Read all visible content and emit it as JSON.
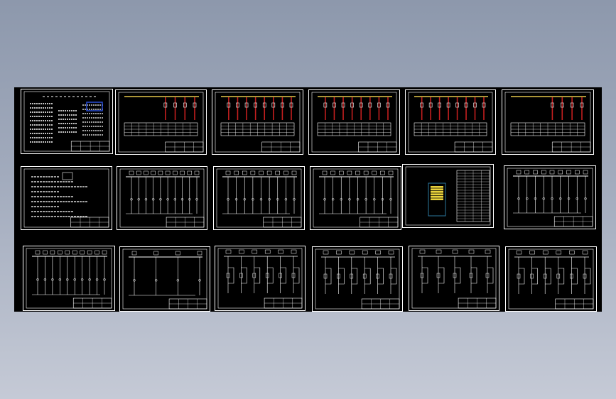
{
  "viewer": {
    "background_color": "#000000",
    "accent_colors": {
      "bus_yellow": "#e6c84a",
      "feeder_red": "#c41f1f",
      "line_white": "#ffffff",
      "cabinet_yellow": "#e8d23c",
      "cabinet_blue": "#2a4fd6",
      "cabinet_green": "#2fb84a"
    }
  },
  "sheets": [
    {
      "type": "index-sheet"
    },
    {
      "type": "feeder-table-sheet",
      "feeders": 4,
      "colored": true
    },
    {
      "type": "feeder-table-sheet",
      "feeders": 8,
      "colored": true
    },
    {
      "type": "feeder-table-sheet",
      "feeders": 8,
      "colored": true
    },
    {
      "type": "feeder-table-sheet",
      "feeders": 8,
      "colored": true
    },
    {
      "type": "feeder-table-sheet",
      "feeders": 4,
      "colored": true
    },
    {
      "type": "notes-sheet"
    },
    {
      "type": "busbar-sheet",
      "feeders": 10
    },
    {
      "type": "busbar-sheet",
      "feeders": 9
    },
    {
      "type": "busbar-sheet",
      "feeders": 9
    },
    {
      "type": "cabinet-layout-sheet"
    },
    {
      "type": "busbar-sheet",
      "feeders": 9
    },
    {
      "type": "busbar-sheet",
      "feeders": 10
    },
    {
      "type": "busbar-sheet",
      "feeders": 4
    },
    {
      "type": "control-circuit-sheet",
      "feeders": 6
    },
    {
      "type": "control-circuit-sheet",
      "feeders": 6
    },
    {
      "type": "control-circuit-sheet",
      "feeders": 5
    },
    {
      "type": "control-circuit-sheet",
      "feeders": 6
    }
  ]
}
